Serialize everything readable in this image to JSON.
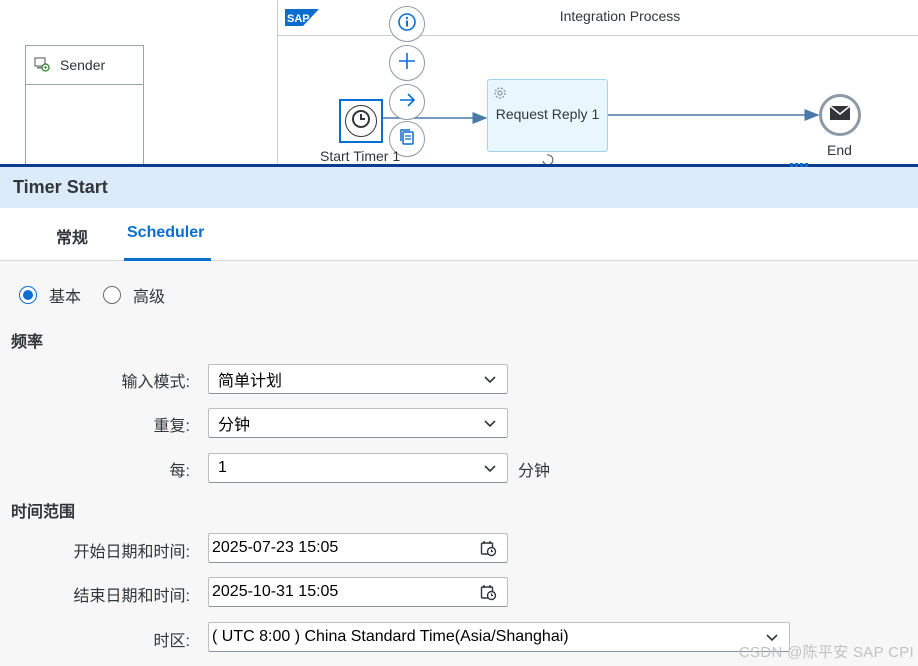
{
  "diagram": {
    "sender_label": "Sender",
    "sap_logo_text": "SAP",
    "process_title": "Integration Process",
    "start_label": "Start Timer 1",
    "request_label": "Request Reply 1",
    "end_label": "End",
    "context_icons": [
      "info-icon",
      "plus-icon",
      "arrow-right-icon",
      "copy-icon"
    ]
  },
  "panel": {
    "title": "Timer Start",
    "tabs": [
      {
        "label": "常规",
        "active": false
      },
      {
        "label": "Scheduler",
        "active": true
      }
    ],
    "mode": {
      "options": [
        {
          "label": "基本",
          "checked": true
        },
        {
          "label": "高级",
          "checked": false
        }
      ]
    },
    "frequency": {
      "heading": "频率",
      "input_mode": {
        "label": "输入模式:",
        "value": "简单计划"
      },
      "repeat": {
        "label": "重复:",
        "value": "分钟"
      },
      "every": {
        "label": "每:",
        "value": "1",
        "unit": "分钟"
      }
    },
    "time_range": {
      "heading": "时间范围",
      "start": {
        "label": "开始日期和时间:",
        "value": "2025-07-23 15:05"
      },
      "end": {
        "label": "结束日期和时间:",
        "value": "2025-10-31 15:05"
      },
      "timezone": {
        "label": "时区:",
        "value": "( UTC 8:00 ) China Standard Time(Asia/Shanghai)"
      }
    }
  },
  "watermark": "CSDN @陈平安 SAP CPI",
  "colors": {
    "accent": "#0a6ed1",
    "header_bg": "#dcebf9",
    "splitter": "#0a3d91",
    "task_fill": "#e8f6fd"
  }
}
